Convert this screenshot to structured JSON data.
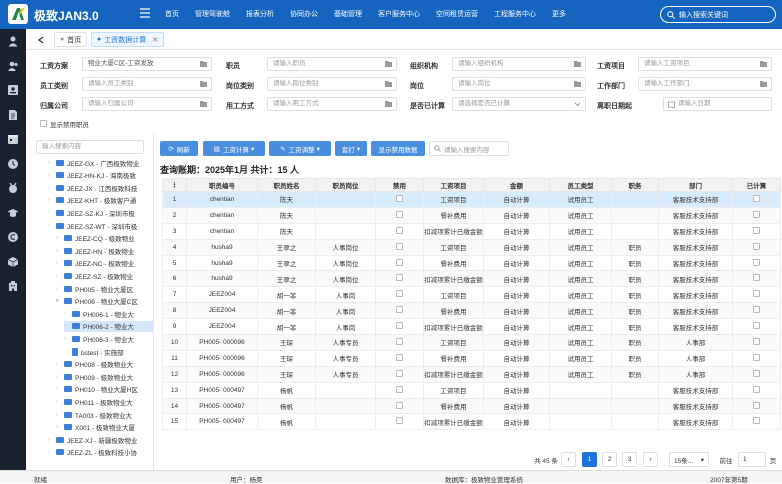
{
  "app": {
    "title": "极致JAN3.0"
  },
  "nav": [
    "首页",
    "管理驾驶舱",
    "报表分析",
    "协同办公",
    "基础管理",
    "客户服务中心",
    "空间租赁运营",
    "工程服务中心",
    "更多"
  ],
  "search": {
    "placeholder": "输入搜索关键词"
  },
  "tabs": {
    "home": "首页",
    "current": "工资数据计算"
  },
  "form": {
    "l1": "工资方案",
    "v1": "物业大厦C区-工资发放",
    "l2": "职员",
    "p2": "请输入职员",
    "l3": "组织机构",
    "p3": "请输入组织机构",
    "l4": "工资项目",
    "p4": "请输入工资项目",
    "l5": "员工类别",
    "p5": "请输入员工类别",
    "l6": "岗位类别",
    "p6": "请输入岗位类别",
    "l7": "岗位",
    "p7": "请输入岗位",
    "l8": "工作部门",
    "p8": "请输入工作部门",
    "l9": "归属公司",
    "p9": "请输入归属公司",
    "l10": "用工方式",
    "p10": "请输入用工方式",
    "l11": "是否已计算",
    "p11": "请选择是否已计算",
    "l12": "离职日期起",
    "p12": "请输入日期",
    "show_disabled": "显示禁用职员"
  },
  "tree": {
    "search_placeholder": "输入搜索内容",
    "nodes": [
      "JEEZ-GX - 广西极致物业",
      "JEEZ-HN-KJ - 海南极致",
      "JEEZ-JX - 江西极致科技",
      "JEEZ-KHT - 极致客户通",
      "JEEZ-SZ-KJ - 深圳市极",
      "JEEZ-SZ-WT - 深圳市极",
      "JEEZ-CQ - 极致物业",
      "JEEZ-HN - 极致物业",
      "JEEZ-NC - 极致物业",
      "JEEZ-SZ - 极致物业",
      "PH005 - 物业大厦区",
      "PH006 - 物业大厦C区",
      "PH006-1 - 物业大",
      "PH006-2 - 物业大",
      "PH006-3 - 物业大",
      "bstest - 实施部",
      "PH008 - 极致物业大",
      "PH009 - 极致物业大",
      "PH010 - 物业大厦H区",
      "PH011 - 极致物业大",
      "TA003 - 极致物业大",
      "X001 - 极致物业大厦",
      "JEEZ-XJ - 新疆极致物业",
      "JEEZ-ZL - 极致科技小协"
    ]
  },
  "toolbar": {
    "refresh": "刷新",
    "calc": "工资计算",
    "adjust": "工资调整",
    "print": "套打",
    "show_disabled": "显示禁用数据",
    "search_placeholder": "请输入搜索内容"
  },
  "period": "查询账期：2025年1月 共计：15 人",
  "columns": [
    "",
    "职员编号",
    "职员姓名",
    "职员岗位",
    "禁用",
    "工资项目",
    "金额",
    "员工类型",
    "职务",
    "部门",
    "已计算"
  ],
  "rows": [
    [
      "1",
      "chentian",
      "陈天",
      "",
      "",
      "工资项目",
      "自动计算",
      "试用员工",
      "",
      "客服技术支持部",
      ""
    ],
    [
      "2",
      "chentian",
      "陈天",
      "",
      "",
      "餐补费用",
      "自动计算",
      "试用员工",
      "",
      "客服技术支持部",
      ""
    ],
    [
      "3",
      "chentian",
      "陈天",
      "",
      "",
      "扣减项累计已缴金额",
      "自动计算",
      "试用员工",
      "",
      "客服技术支持部",
      ""
    ],
    [
      "4",
      "husha9",
      "王翠之",
      "人事岗位",
      "",
      "工资项目",
      "自动计算",
      "试用员工",
      "职员",
      "客服技术支持部",
      ""
    ],
    [
      "5",
      "husha9",
      "王翠之",
      "人事岗位",
      "",
      "餐补费用",
      "自动计算",
      "试用员工",
      "职员",
      "客服技术支持部",
      ""
    ],
    [
      "6",
      "husha9",
      "王翠之",
      "人事岗位",
      "",
      "扣减项累计已缴金额",
      "自动计算",
      "试用员工",
      "职员",
      "客服技术支持部",
      ""
    ],
    [
      "7",
      "JEEZ004",
      "胡一菲",
      "人事岗",
      "",
      "工资项目",
      "自动计算",
      "试用员工",
      "职员",
      "客服技术支持部",
      ""
    ],
    [
      "8",
      "JEEZ004",
      "胡一菲",
      "人事岗",
      "",
      "餐补费用",
      "自动计算",
      "试用员工",
      "职员",
      "客服技术支持部",
      ""
    ],
    [
      "9",
      "JEEZ004",
      "胡一菲",
      "人事岗",
      "",
      "扣减项累计已缴金额",
      "自动计算",
      "试用员工",
      "职员",
      "客服技术支持部",
      ""
    ],
    [
      "10",
      "PH005- 000096",
      "王琛",
      "人事专员",
      "",
      "工资项目",
      "自动计算",
      "试用员工",
      "职员",
      "人事部",
      ""
    ],
    [
      "11",
      "PH005- 000096",
      "王琛",
      "人事专员",
      "",
      "餐补费用",
      "自动计算",
      "试用员工",
      "职员",
      "人事部",
      ""
    ],
    [
      "12",
      "PH005- 000096",
      "王琛",
      "人事专员",
      "",
      "扣减项累计已缴金额",
      "自动计算",
      "试用员工",
      "职员",
      "人事部",
      ""
    ],
    [
      "13",
      "PH005- 000497",
      "杨帆",
      "",
      "",
      "工资项目",
      "自动计算",
      "",
      "",
      "客服技术支持部",
      ""
    ],
    [
      "14",
      "PH005- 000497",
      "杨帆",
      "",
      "",
      "餐补费用",
      "自动计算",
      "",
      "",
      "客服技术支持部",
      ""
    ],
    [
      "15",
      "PH005- 000497",
      "杨帆",
      "",
      "",
      "扣减项累计已缴金额",
      "自动计算",
      "",
      "",
      "客服技术支持部",
      ""
    ]
  ],
  "pager": {
    "total": "共 45 条",
    "p1": "1",
    "p2": "2",
    "p3": "3",
    "size": "15条...",
    "goto": "前往",
    "page": "1",
    "unit": "页"
  },
  "status": {
    "ready": "就绪",
    "user": "用户：杨昊",
    "db": "数据库：极致物业管理系统",
    "period": "2007年第5期"
  }
}
